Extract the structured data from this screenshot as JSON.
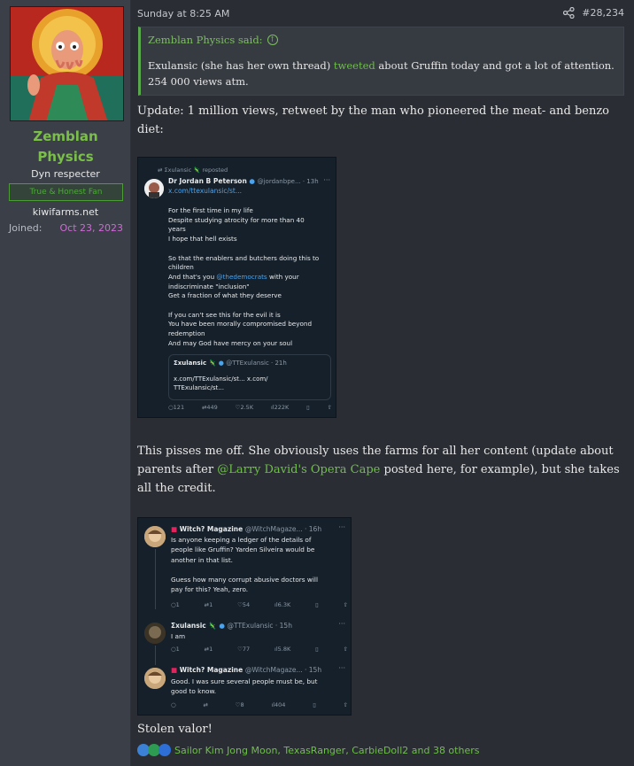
{
  "user": {
    "name_line1": "Zemblan",
    "name_line2": "Physics",
    "title": "Dyn respecter",
    "banner": "True & Honest Fan",
    "site": "kiwifarms.net",
    "joined_label": "Joined:",
    "joined_value": "Oct 23, 2023"
  },
  "post": {
    "date": "Sunday at 8:25 AM",
    "number": "#28,234",
    "quote": {
      "author": "Zemblan Physics said:",
      "body_before_link": "Exulansic (she has her own thread) ",
      "link": "tweeted",
      "body_after_link": " about Gruffin today and got a lot of attention. 254 000 views atm."
    },
    "update_text": "Update: 1 million views, retweet by the man who pioneered the meat- and benzo diet:",
    "para2_before": "This pisses me off. She obviously uses the farms for all her content (update about parents after ",
    "para2_link": "@Larry David's Opera Cape",
    "para2_after": " posted here, for example), but she takes all the credit.",
    "closing": "Stolen valor!",
    "reactions": "Sailor Kim Jong Moon, TexasRanger, CarbieDoll2 and 38 others"
  },
  "tweet1": {
    "repost": "Σxulansic 🦎 reposted",
    "author": "Dr Jordan B Peterson",
    "handle": "@jordanbpe... · 13h",
    "link": "x.com/ttexulansic/st...",
    "lines": [
      "For the first time in my life",
      "Despite studying atrocity for more than 40",
      "years",
      "I hope that hell exists",
      "",
      "So that the enablers and butchers doing this to",
      "children",
      "",
      "Get a fraction of what they deserve",
      "",
      "If you can't see this for the evil it is",
      "You have been morally compromised beyond",
      "redemption",
      "And may God have mercy on your soul"
    ],
    "line_mention_pre": "And that's you ",
    "line_mention": "@thedemocrats",
    "line_mention_post": " with your",
    "line_mention_2": "indiscriminate \"inclusion\"",
    "quoted_author": "Σxulansic 🦎",
    "quoted_handle": "@TTExulansic · 21h",
    "quoted_body_1": "x.com/TTExulansic/st... x.com/",
    "quoted_body_2": "TTExulansic/st...",
    "stats": [
      "121",
      "449",
      "2.5K",
      "222K"
    ]
  },
  "tweet2": {
    "t1_author": "Witch? Magazine",
    "t1_handle": "@WitchMagaze... · 16h",
    "t1_lines": [
      "Is anyone keeping a ledger of the details of",
      "people like Gruffin? Yarden Silveira would be",
      "another in that list.",
      "",
      "Guess how many corrupt abusive doctors will",
      "pay for this? Yeah, zero."
    ],
    "t1_stats": [
      "1",
      "1",
      "54",
      "6.3K"
    ],
    "t2_author": "Σxulansic 🦎",
    "t2_handle": "@TTExulansic · 15h",
    "t2_body": "I am",
    "t2_stats": [
      "1",
      "1",
      "77",
      "5.8K"
    ],
    "t3_author": "Witch? Magazine",
    "t3_handle": "@WitchMagaze... · 15h",
    "t3_lines": [
      "Good. I was sure several people must be, but",
      "good to know."
    ],
    "t3_stats": [
      "",
      "",
      "8",
      "404"
    ]
  },
  "colors": {
    "accent_green": "#6fbf4a",
    "joined_pink": "#d06ad6",
    "tweet_bg": "#15202b"
  }
}
